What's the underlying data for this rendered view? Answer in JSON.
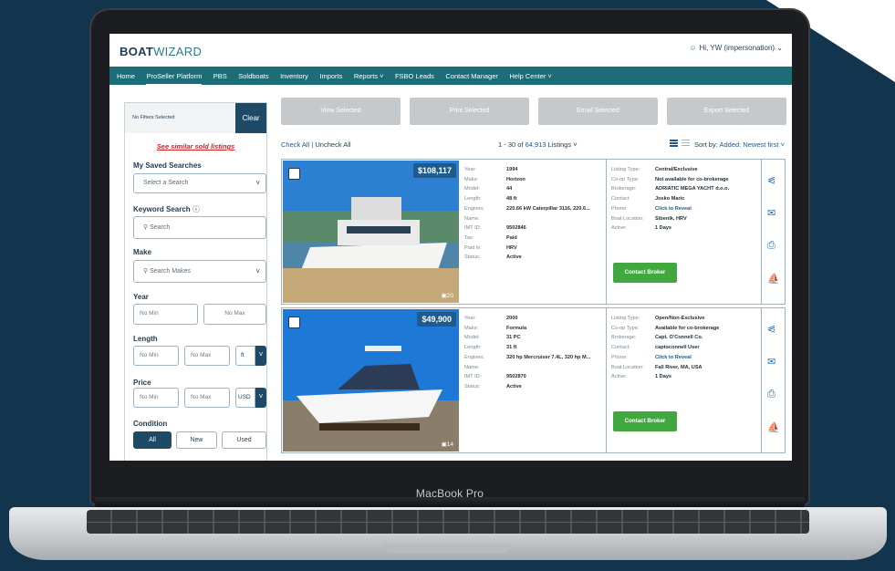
{
  "device": {
    "label": "MacBook Pro"
  },
  "app": {
    "logo_bold": "BOAT",
    "logo_light": "WIZARD",
    "user": "Hi, YW (impersonation)",
    "nav": [
      "Home",
      "ProSeller Platform",
      "PBS",
      "Soldboats",
      "Inventory",
      "Imports",
      "Reports",
      "FSBO Leads",
      "Contact Manager",
      "Help Center"
    ]
  },
  "sidebar": {
    "filters_label": "No Filters Selected",
    "clear": "Clear",
    "similar_sold": "See similar sold listings",
    "saved_searches": "My Saved Searches",
    "saved_searches_placeholder": "Select a Search",
    "keyword_search": "Keyword Search",
    "keyword_placeholder": "Search",
    "make": "Make",
    "make_placeholder": "Search Makes",
    "year": "Year",
    "length": "Length",
    "price": "Price",
    "no_min": "No Min",
    "no_max": "No Max",
    "length_unit": "ft",
    "price_unit": "USD",
    "condition": "Condition",
    "condition_options": [
      "All",
      "New",
      "Used"
    ]
  },
  "toolbar": {
    "actions": [
      "View Selected",
      "Print Selected",
      "Email Selected",
      "Export Selected"
    ],
    "check_all": "Check All",
    "uncheck_all": "Uncheck All",
    "count_prefix": "1 - 30 of",
    "count_total": "64,913",
    "count_suffix": "Listings",
    "sort_label": "Sort by:",
    "sort_value": "Added: Newest first"
  },
  "listings": [
    {
      "price": "$108,117",
      "photos": "20",
      "year": "1994",
      "make": "Horizon",
      "model": "44",
      "length": "48 ft",
      "engines": "220.66 kW Caterpillar 3116, 220.6...",
      "name": "",
      "imt_id": "9502846",
      "tax": "Paid",
      "paid_in": "HRV",
      "status": "Active",
      "listing_type": "Central/Exclusive",
      "coop_type": "Not available for co-brokerage",
      "brokerage": "ADRIATIC MEGA YACHT d.o.o.",
      "contact": "Josko Maric",
      "phone": "Click to Reveal",
      "boat_location": "Sibenik, HRV",
      "active": "1 Days",
      "contact_broker": "Contact Broker"
    },
    {
      "price": "$49,900",
      "photos": "14",
      "year": "2000",
      "make": "Formula",
      "model": "31 PC",
      "length": "31 ft",
      "engines": "320 hp Mercruiser 7.4L, 320 hp M...",
      "name": "",
      "imt_id": "9502870",
      "status": "Active",
      "listing_type": "Open/Non-Exclusive",
      "coop_type": "Available for co-brokerage",
      "brokerage": "Capt. O'Connell Co.",
      "contact": "captoconnell User",
      "phone": "Click to Reveal",
      "boat_location": "Fall River, MA, USA",
      "active": "1 Days",
      "contact_broker": "Contact Broker"
    }
  ],
  "labels": {
    "year": "Year:",
    "make": "Make:",
    "model": "Model:",
    "length": "Length:",
    "engines": "Engines:",
    "name": "Name:",
    "imt_id": "IMT ID:",
    "tax": "Tax:",
    "paid_in": "Paid In:",
    "status": "Status:",
    "listing_type": "Listing Type:",
    "coop_type": "Co-op Type:",
    "brokerage": "Brokerage:",
    "contact": "Contact:",
    "phone": "Phone:",
    "boat_location": "Boat Location:",
    "active": "Active:"
  },
  "colors": {
    "nav": "#1c6d77",
    "primary": "#1f4a66",
    "link": "#1f5a8c",
    "cta": "#40a83f",
    "alert": "#d21f26"
  }
}
